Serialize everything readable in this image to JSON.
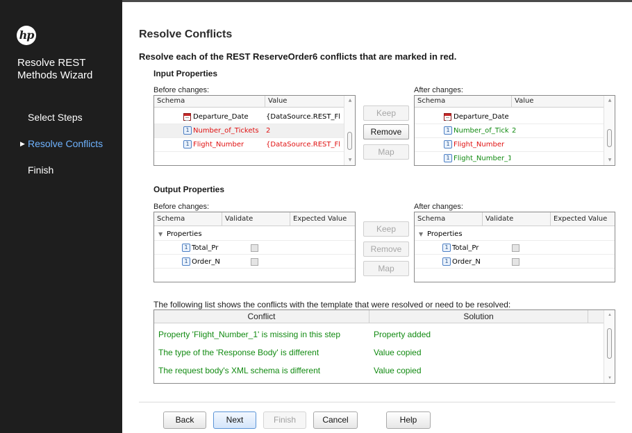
{
  "sidebar": {
    "logo_text": "hp",
    "wizard_title": "Resolve REST Methods Wizard",
    "items": [
      {
        "label": "Select Steps"
      },
      {
        "label": "Resolve Conflicts"
      },
      {
        "label": "Finish"
      }
    ]
  },
  "main": {
    "title": "Resolve Conflicts",
    "subtitle": "Resolve each of the REST ReserveOrder6 conflicts that are marked in red.",
    "input": {
      "title": "Input Properties",
      "before_label": "Before changes:",
      "after_label": "After changes:",
      "before_headers": [
        "Schema",
        "Value"
      ],
      "before_rows": [
        {
          "name": "Departure_Date",
          "value": "{DataSource.REST_Fl",
          "icon": "date-icon"
        },
        {
          "name": "Number_of_Tickets",
          "value": "2",
          "icon": "param-icon"
        },
        {
          "name": "Flight_Number",
          "value": "{DataSource.REST_Fl",
          "icon": "param-icon"
        }
      ],
      "after_headers": [
        "Schema",
        "Value"
      ],
      "after_rows": [
        {
          "name": "Departure_Date",
          "value": "",
          "icon": "date-icon"
        },
        {
          "name": "Number_of_Tick",
          "value": "2",
          "icon": "param-icon"
        },
        {
          "name": "Flight_Number",
          "value": "",
          "icon": "param-icon"
        },
        {
          "name": "Flight_Number_1",
          "value": "",
          "icon": "param-icon"
        }
      ],
      "buttons": {
        "keep": "Keep",
        "remove": "Remove",
        "map": "Map"
      }
    },
    "output": {
      "title": "Output Properties",
      "before_label": "Before changes:",
      "after_label": "After changes:",
      "headers": [
        "Schema",
        "Validate",
        "Expected Value"
      ],
      "group": "Properties",
      "before_rows": [
        {
          "name": "Total_Pr"
        },
        {
          "name": "Order_N"
        }
      ],
      "after_rows": [
        {
          "name": "Total_Pr"
        },
        {
          "name": "Order_N"
        }
      ],
      "buttons": {
        "keep": "Keep",
        "remove": "Remove",
        "map": "Map"
      }
    },
    "conflicts": {
      "label": "The following list shows the conflicts with the template that were resolved or need to be resolved:",
      "headers": [
        "Conflict",
        "Solution"
      ],
      "rows": [
        {
          "conflict": "Property 'Flight_Number_1' is missing in this step",
          "solution": "Property added"
        },
        {
          "conflict": "The type of the 'Response Body' is different",
          "solution": "Value copied"
        },
        {
          "conflict": "The request body's XML schema is different",
          "solution": "Value copied"
        }
      ]
    }
  },
  "footer": {
    "back": "Back",
    "next": "Next",
    "finish": "Finish",
    "cancel": "Cancel",
    "help": "Help"
  },
  "colors": {
    "sidebar_bg": "#1e1e1e",
    "active_nav": "#6fb3ff",
    "conflict_red": "#e01010",
    "resolved_green": "#118a11"
  }
}
